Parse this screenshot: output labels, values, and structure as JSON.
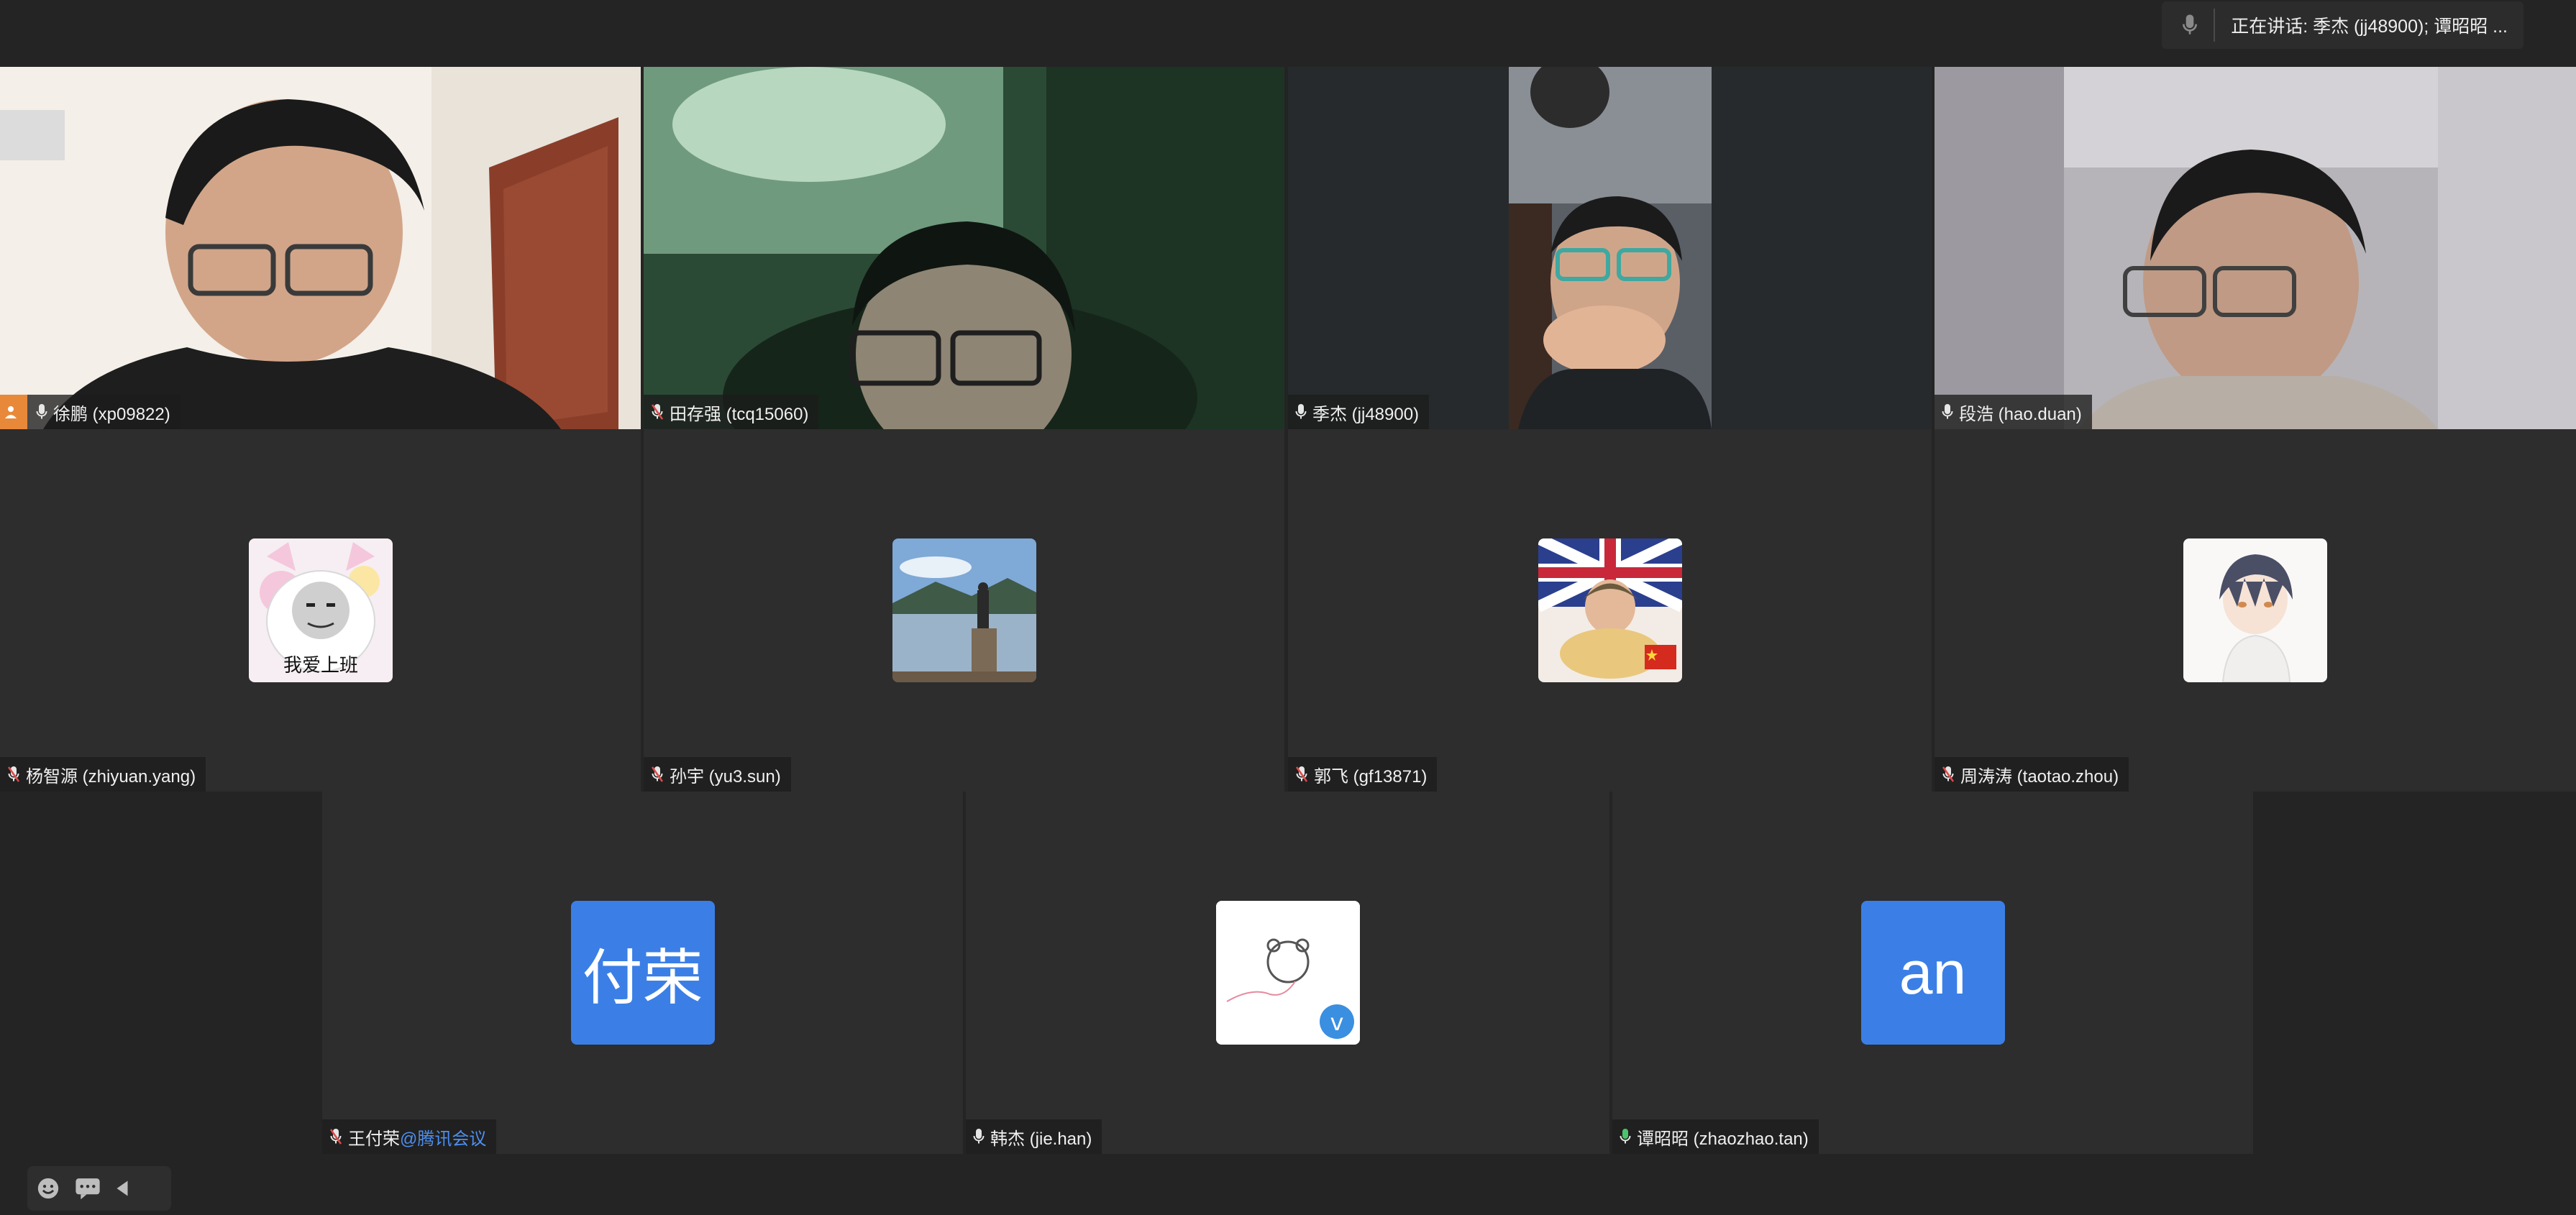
{
  "speaking_bar": {
    "text": "正在讲话: 季杰 (jj48900); 谭昭昭 ..."
  },
  "participants": [
    {
      "name": "徐鹏 (xp09822)",
      "mic": "on"
    },
    {
      "name": "田存强 (tcq15060)",
      "mic": "muted"
    },
    {
      "name": "季杰 (jj48900)",
      "mic": "on"
    },
    {
      "name": "段浩 (hao.duan)",
      "mic": "on"
    },
    {
      "name": "杨智源 (zhiyuan.yang)",
      "mic": "muted"
    },
    {
      "name": "孙宇 (yu3.sun)",
      "mic": "muted"
    },
    {
      "name": "郭飞 (gf13871)",
      "mic": "muted"
    },
    {
      "name": "周涛涛 (taotao.zhou)",
      "mic": "muted"
    },
    {
      "name": "王付荣",
      "name_suffix": "@腾讯会议",
      "avatar_text": "付荣",
      "mic": "muted"
    },
    {
      "name": "韩杰 (jie.han)",
      "mic": "on"
    },
    {
      "name": "谭昭昭 (zhaozhao.tan)",
      "avatar_text": "an",
      "mic": "speaking"
    }
  ],
  "avatar_caption": "我爱上班",
  "colors": {
    "active_speaker_border": "#4cc46b",
    "letter_avatar_bg": "#3b7fe6",
    "host_badge": "#e8893a",
    "mute_slash": "#e04a4a"
  },
  "icons": [
    "mic-icon",
    "mic-muted-icon",
    "host-icon",
    "emoji-icon",
    "chat-icon",
    "collapse-arrow-icon"
  ]
}
